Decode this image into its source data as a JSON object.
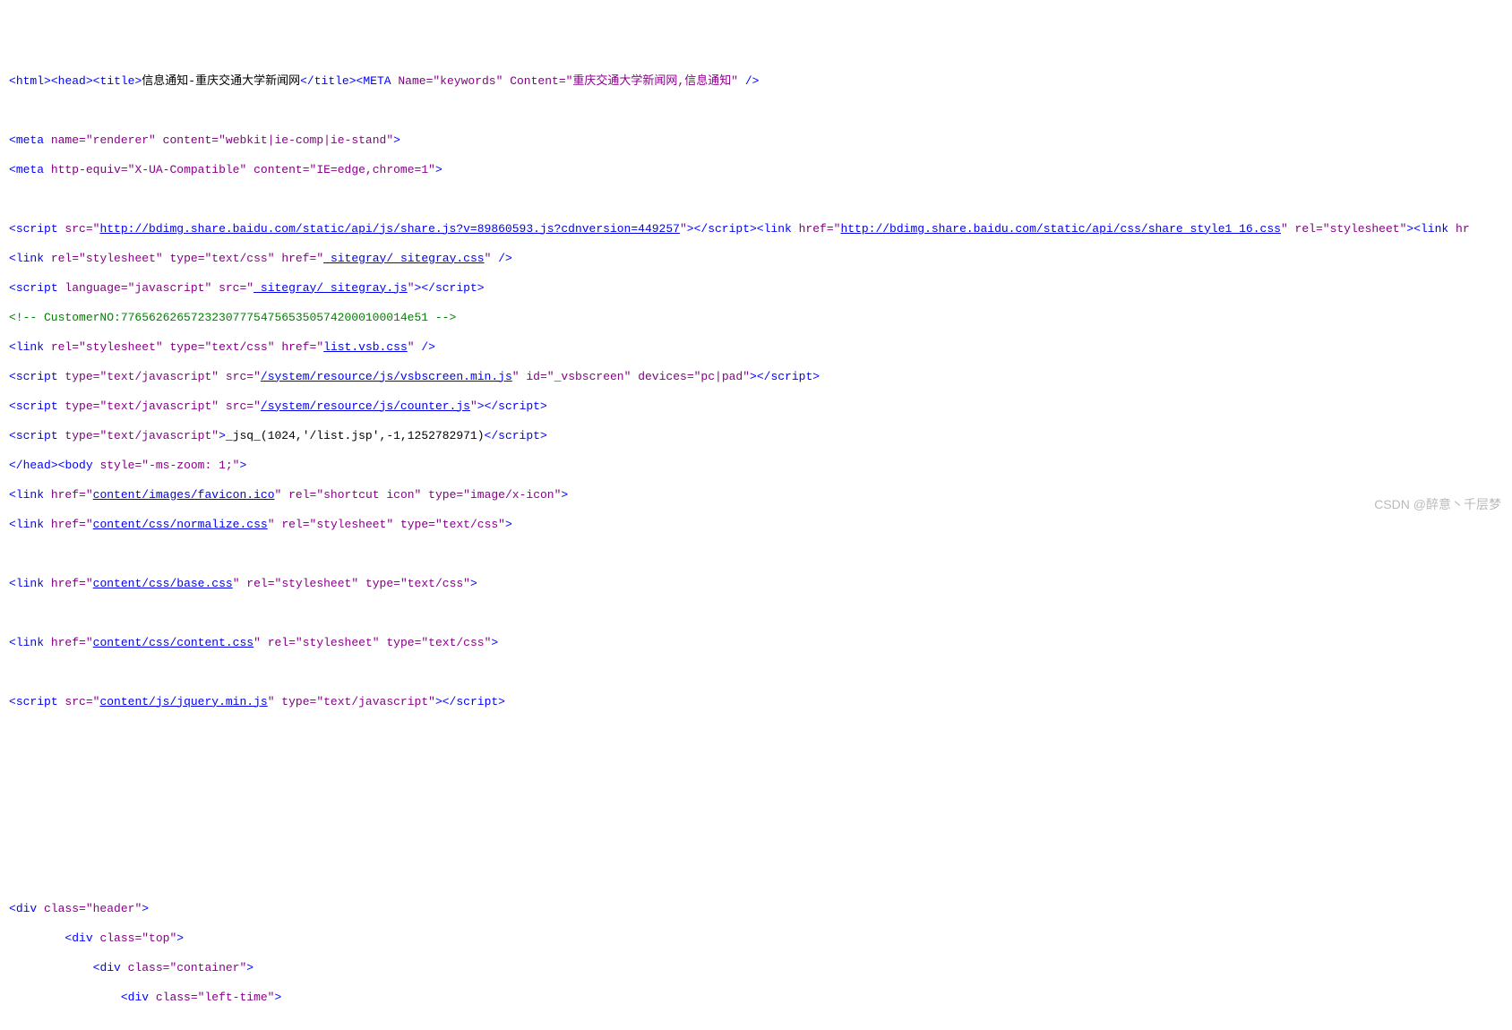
{
  "watermark": "CSDN @醉意丶千层梦",
  "gutter": [
    "",
    "",
    "",
    "",
    "",
    "",
    "",
    "",
    "",
    "",
    "",
    "",
    "",
    "",
    "",
    "",
    "",
    "",
    "",
    "",
    "",
    "",
    "",
    "",
    "",
    "",
    "",
    "",
    "",
    "",
    "",
    "",
    ""
  ],
  "code": {
    "l1": {
      "a": "<",
      "b": "html",
      "c": "><",
      "d": "head",
      "e": "><",
      "f": "title",
      "g": ">",
      "h": "信息通知-重庆交通大学新闻网",
      "i": "</",
      "j": "title",
      "k": "><",
      "l": "META",
      "m": " Name",
      "n": "=\"keywords\"",
      "o": " Content",
      "p": "=\"重庆交通大学新闻网,信息通知\"",
      "q": " />"
    },
    "l2_blank": "",
    "l3": {
      "a": "<",
      "b": "meta",
      "c": " name",
      "d": "=\"renderer\"",
      "e": " content",
      "f": "=\"webkit|ie-comp|ie-stand\"",
      "g": ">"
    },
    "l4": {
      "a": "<",
      "b": "meta",
      "c": " http-equiv",
      "d": "=\"X-UA-Compatible\"",
      "e": " content",
      "f": "=\"IE=edge,chrome=1\"",
      "g": ">"
    },
    "l5_blank": "",
    "l6": {
      "a": "<",
      "b": "script",
      "c": " src",
      "d": "=\"",
      "e": "http://bdimg.share.baidu.com/static/api/js/share.js?v=89860593.js?cdnversion=449257",
      "f": "\"",
      "g": "></",
      "h": "script",
      "i": "><",
      "j": "link",
      "k": " href",
      "l": "=\"",
      "m": "http://bdimg.share.baidu.com/static/api/css/share_style1_16.css",
      "n": "\"",
      "o": " rel",
      "p": "=\"stylesheet\"",
      "q": "><",
      "r": "link",
      "s": " hr"
    },
    "l7": {
      "a": "<",
      "b": "link",
      "c": " rel",
      "d": "=\"stylesheet\"",
      "e": " type",
      "f": "=\"text/css\"",
      "g": " href",
      "h": "=\"",
      "i": "_sitegray/_sitegray.css",
      "j": "\"",
      "k": " />"
    },
    "l8": {
      "a": "<",
      "b": "script",
      "c": " language",
      "d": "=\"javascript\"",
      "e": " src",
      "f": "=\"",
      "g": "_sitegray/_sitegray.js",
      "h": "\"",
      "i": "></",
      "j": "script",
      "k": ">"
    },
    "l9": "<!-- CustomerNO:77656262657232307775475653505742000100014e51 -->",
    "l10": {
      "a": "<",
      "b": "link",
      "c": " rel",
      "d": "=\"stylesheet\"",
      "e": " type",
      "f": "=\"text/css\"",
      "g": " href",
      "h": "=\"",
      "i": "list.vsb.css",
      "j": "\"",
      "k": " />"
    },
    "l11": {
      "a": "<",
      "b": "script",
      "c": " type",
      "d": "=\"text/javascript\"",
      "e": " src",
      "f": "=\"",
      "g": "/system/resource/js/vsbscreen.min.js",
      "h": "\"",
      "i": " id",
      "j": "=\"_vsbscreen\"",
      "k": " devices",
      "l": "=\"pc|pad\"",
      "m": "></",
      "n": "script",
      "o": ">"
    },
    "l12": {
      "a": "<",
      "b": "script",
      "c": " type",
      "d": "=\"text/javascript\"",
      "e": " src",
      "f": "=\"",
      "g": "/system/resource/js/counter.js",
      "h": "\"",
      "i": "></",
      "j": "script",
      "k": ">"
    },
    "l13": {
      "a": "<",
      "b": "script",
      "c": " type",
      "d": "=\"text/javascript\"",
      "e": ">",
      "f": "_jsq_(1024,'/list.jsp',-1,1252782971)",
      "g": "</",
      "h": "script",
      "i": ">"
    },
    "l14": {
      "a": "</",
      "b": "head",
      "c": "><",
      "d": "body",
      "e": " style",
      "f": "=\"-ms-zoom: 1;\"",
      "g": ">"
    },
    "l15": {
      "a": "<",
      "b": "link",
      "c": " href",
      "d": "=\"",
      "e": "content/images/favicon.ico",
      "f": "\"",
      "g": " rel",
      "h": "=\"shortcut icon\"",
      "i": " type",
      "j": "=\"image/x-icon\"",
      "k": ">"
    },
    "l16": {
      "a": "<",
      "b": "link",
      "c": " href",
      "d": "=\"",
      "e": "content/css/normalize.css",
      "f": "\"",
      "g": " rel",
      "h": "=\"stylesheet\"",
      "i": " type",
      "j": "=\"text/css\"",
      "k": ">"
    },
    "l17_blank": "",
    "l18": {
      "a": "<",
      "b": "link",
      "c": " href",
      "d": "=\"",
      "e": "content/css/base.css",
      "f": "\"",
      "g": " rel",
      "h": "=\"stylesheet\"",
      "i": " type",
      "j": "=\"text/css\"",
      "k": ">"
    },
    "l19_blank": "",
    "l20": {
      "a": "<",
      "b": "link",
      "c": " href",
      "d": "=\"",
      "e": "content/css/content.css",
      "f": "\"",
      "g": " rel",
      "h": "=\"stylesheet\"",
      "i": " type",
      "j": "=\"text/css\"",
      "k": ">"
    },
    "l21_blank": "",
    "l22": {
      "a": "<",
      "b": "script",
      "c": " src",
      "d": "=\"",
      "e": "content/js/jquery.min.js",
      "f": "\"",
      "g": " type",
      "h": "=\"text/javascript\"",
      "i": "></",
      "j": "script",
      "k": ">"
    },
    "l23_blank": "",
    "l24_blank": "",
    "l25_blank": "",
    "l26_blank": "",
    "l27_blank": "",
    "l28_blank": "",
    "l29": {
      "a": "<",
      "b": "div",
      "c": " class",
      "d": "=\"header\"",
      "e": ">"
    },
    "l30": {
      "pad": "        ",
      "a": "<",
      "b": "div",
      "c": " class",
      "d": "=\"top\"",
      "e": ">"
    },
    "l31": {
      "pad": "            ",
      "a": "<",
      "b": "div",
      "c": " class",
      "d": "=\"container\"",
      "e": ">"
    },
    "l32": {
      "pad": "                ",
      "a": "<",
      "b": "div",
      "c": " class",
      "d": "=\"left-time\"",
      "e": ">"
    }
  }
}
